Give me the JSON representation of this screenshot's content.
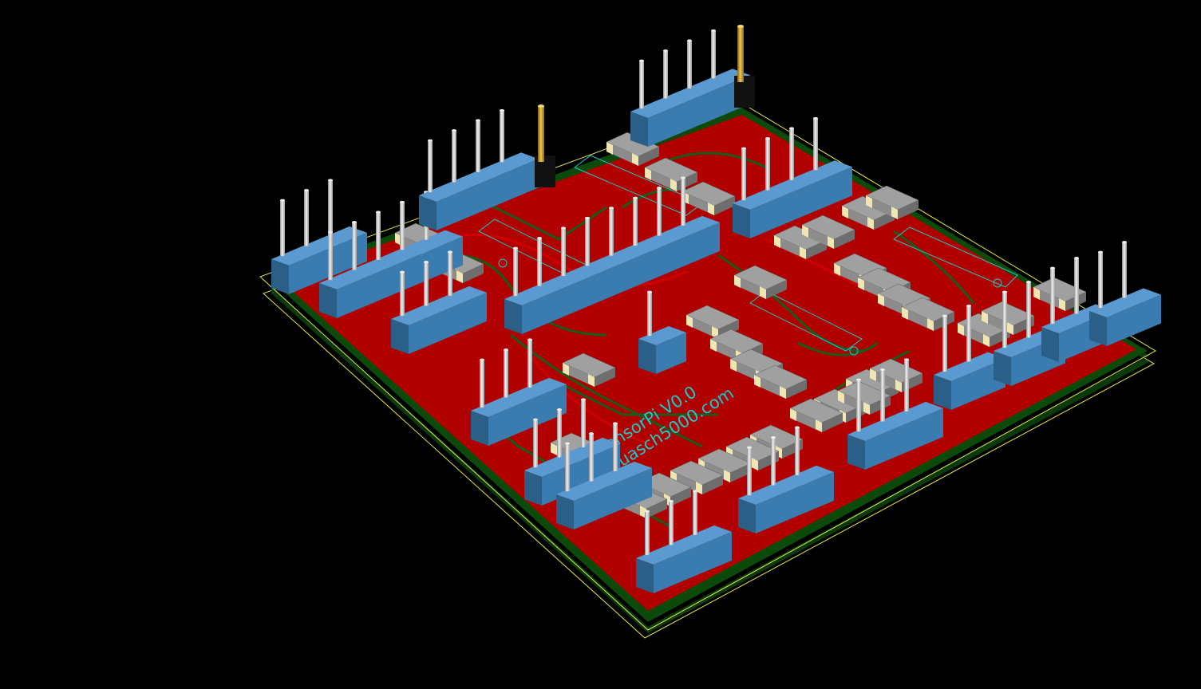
{
  "viewer": {
    "background_color": "#000000"
  },
  "board": {
    "silkscreen_lines": [
      "SensorPi V0.0",
      "Guasch5000.com"
    ],
    "colors": {
      "copper": "#b00000",
      "copper_trace": "#d00000",
      "soldermask_green": "#0c4a0c",
      "outline": "#e6e64a",
      "silkscreen": "#1ec8c8",
      "header_body": "#3a7bb0",
      "header_pin": "#cfcfcf",
      "jumper_body": "#111111",
      "jumper_pin": "#c8a020",
      "smd_body": "#8c8c8c",
      "smd_cap": "#f0e6b4"
    }
  }
}
